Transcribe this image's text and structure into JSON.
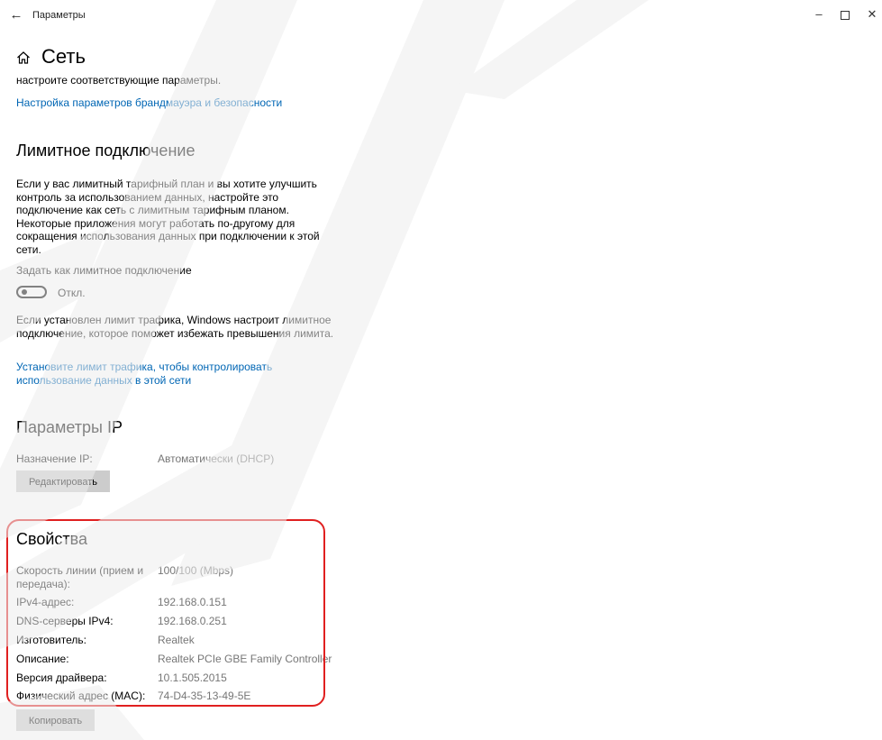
{
  "window": {
    "app_title": "Параметры",
    "back_icon": "←",
    "minimize_icon": "–",
    "close_icon": "✕"
  },
  "page": {
    "title": "Сеть"
  },
  "firewall": {
    "intro_tail": "настроите соответствующие параметры.",
    "link": "Настройка параметров брандмауэра и безопасности"
  },
  "metered": {
    "heading": "Лимитное подключение",
    "description": "Если у вас лимитный тарифный план и вы хотите улучшить контроль за использованием данных, настройте это подключение как сеть с лимитным тарифным планом. Некоторые приложения могут работать по-другому для сокращения использования данных при подключении к этой сети.",
    "toggle_label": "Задать как лимитное подключение",
    "toggle_state": "Откл.",
    "limit_note": "Если установлен лимит трафика, Windows настроит лимитное подключение, которое поможет избежать превышения лимита.",
    "limit_link": "Установите лимит трафика, чтобы контролировать использование данных в этой сети"
  },
  "ip": {
    "heading": "Параметры IP",
    "assignment_label": "Назначение IP:",
    "assignment_value": "Автоматически (DHCP)",
    "edit_button": "Редактировать"
  },
  "properties": {
    "heading": "Свойства",
    "rows": [
      {
        "label": "Скорость линии (прием и передача):",
        "value": "100/100 (Mbps)"
      },
      {
        "label": "IPv4-адрес:",
        "value": "192.168.0.151"
      },
      {
        "label": "DNS-серверы IPv4:",
        "value": "192.168.0.251"
      },
      {
        "label": "Изготовитель:",
        "value": "Realtek"
      },
      {
        "label": "Описание:",
        "value": "Realtek PCIe GBE Family Controller"
      },
      {
        "label": "Версия драйвера:",
        "value": "10.1.505.2015"
      },
      {
        "label": "Физический адрес (MAC):",
        "value": "74-D4-35-13-49-5E"
      }
    ],
    "copy_button": "Копировать"
  },
  "colors": {
    "link": "#0066b4",
    "highlight": "#e02020",
    "value_text": "#767676",
    "button_bg": "#cccccc",
    "watermark": "#ededed"
  }
}
